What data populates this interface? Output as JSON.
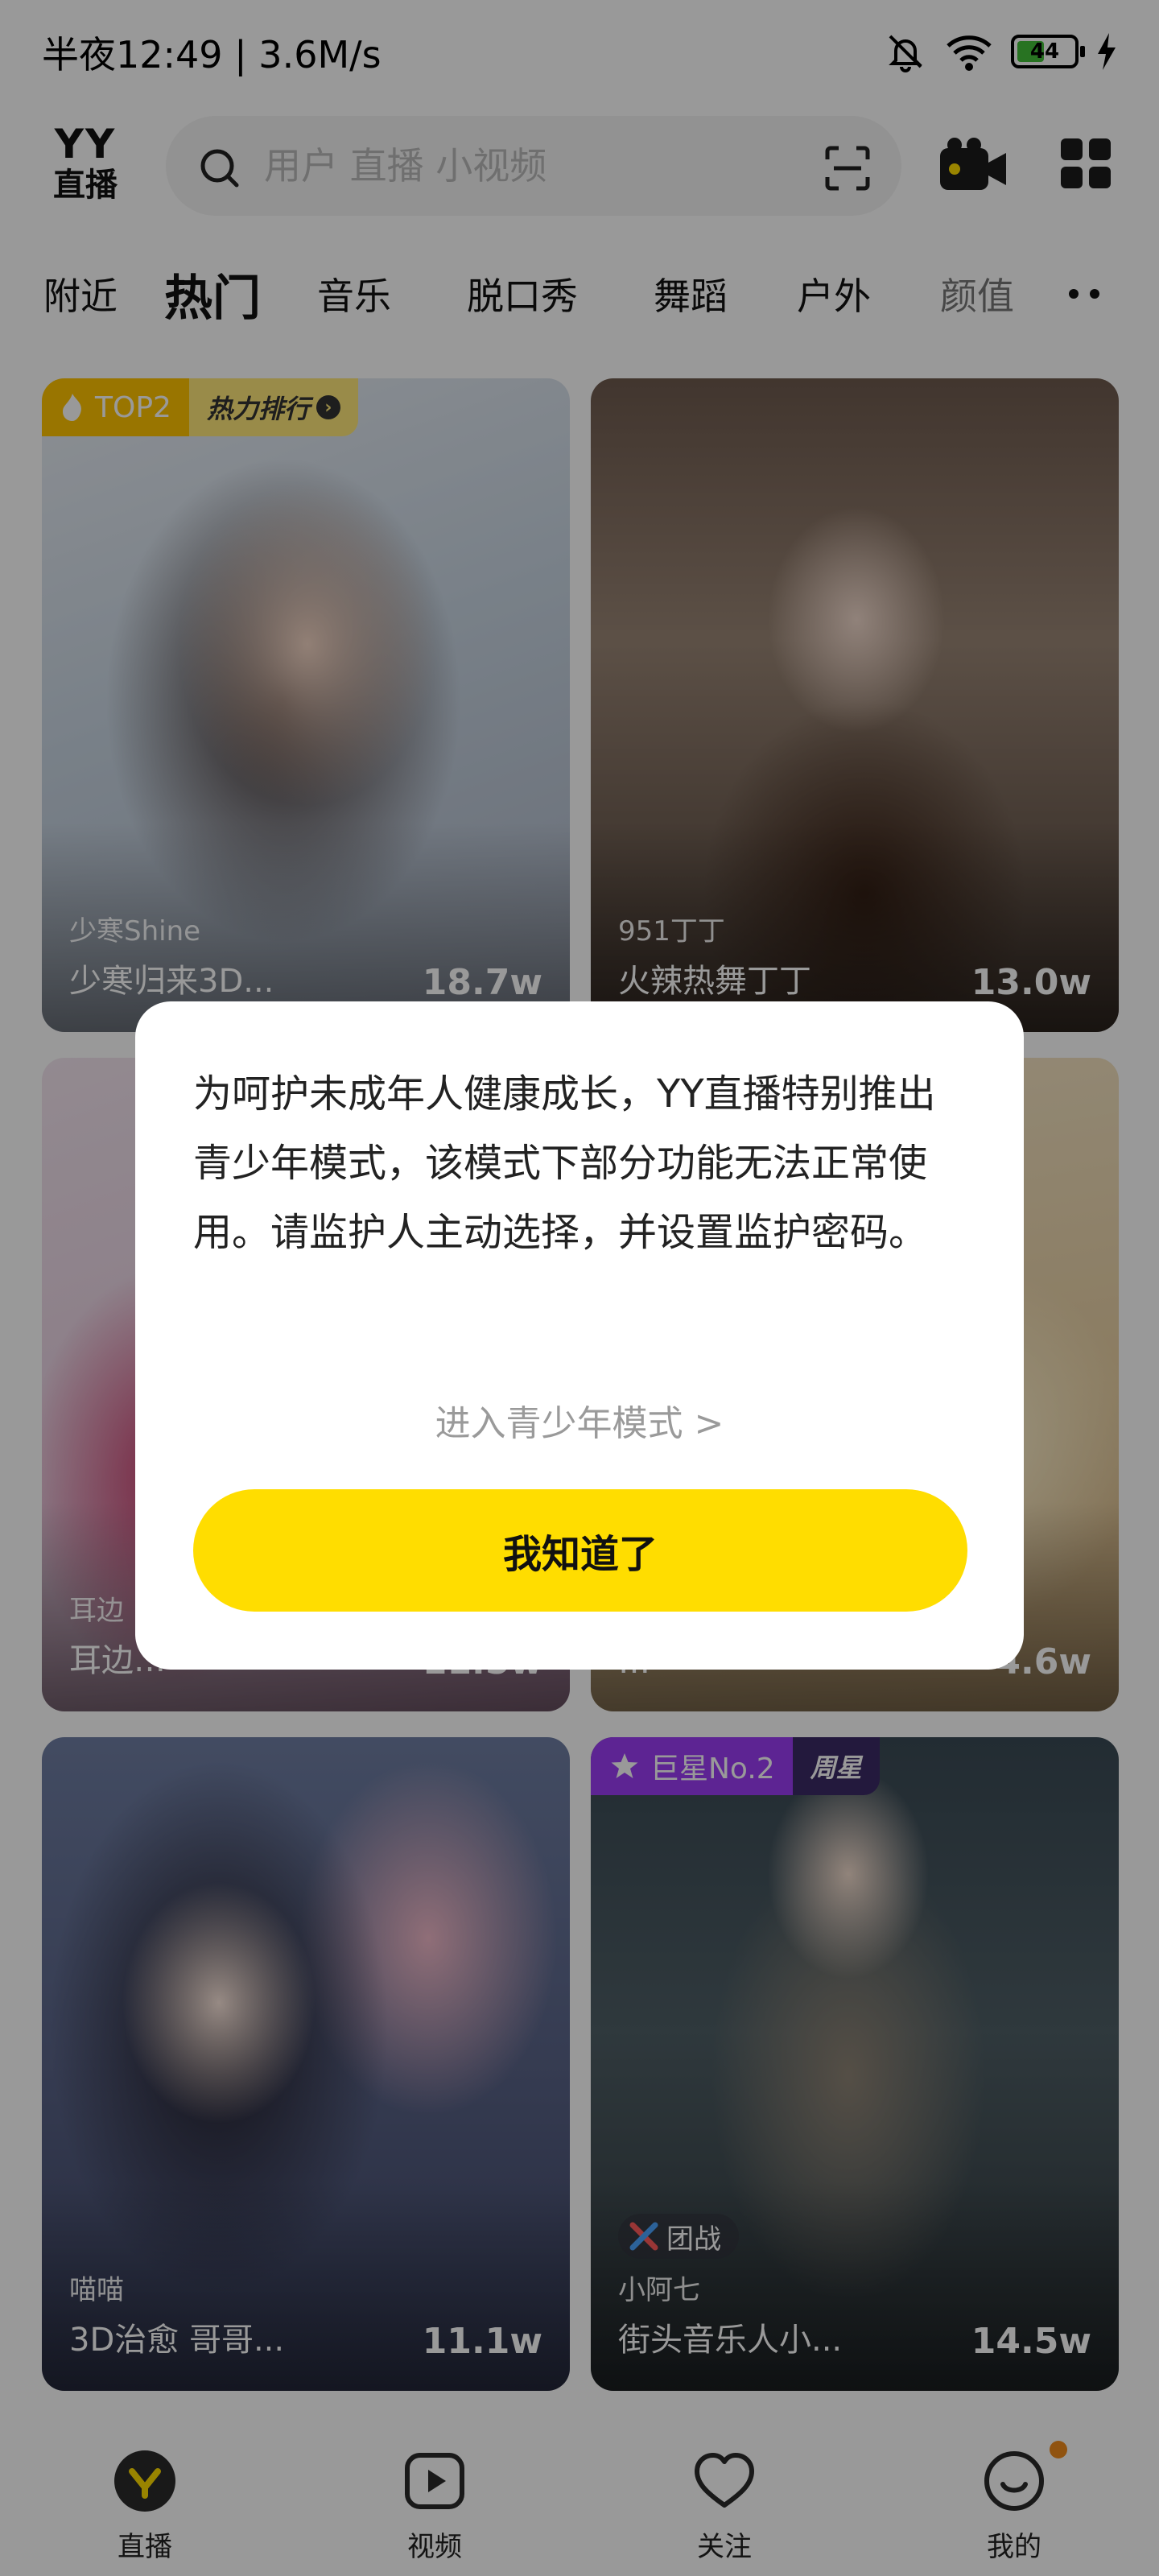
{
  "status_bar": {
    "text": "半夜12:49 | 3.6M/s",
    "battery": "44"
  },
  "header": {
    "logo_top": "YY",
    "logo_bottom": "直播",
    "search_placeholder": "用户 直播 小视频"
  },
  "tabs": [
    "附近",
    "热门",
    "音乐",
    "脱口秀",
    "舞蹈",
    "户外",
    "颜值"
  ],
  "active_tab": "热门",
  "cards": [
    {
      "user": "少寒Shine",
      "title": "少寒归来3D...",
      "views": "18.7w",
      "tag_a": "TOP2",
      "tag_b": "热力排行"
    },
    {
      "user": "951丁丁",
      "title": "火辣热舞丁丁",
      "views": "13.0w"
    },
    {
      "user": "耳边",
      "title": "耳边…",
      "views": "11.5w"
    },
    {
      "user": "",
      "title": "…",
      "views": "4.6w"
    },
    {
      "user": "喵喵",
      "title": "3D治愈 哥哥...",
      "views": "11.1w"
    },
    {
      "user": "小阿七",
      "title": "街头音乐人小...",
      "views": "14.5w",
      "tag_a": "巨星No.2",
      "tag_b": "周星",
      "team": "团战"
    }
  ],
  "dialog": {
    "message": "为呵护未成年人健康成长，YY直播特别推出青少年模式，该模式下部分功能无法正常使用。请监护人主动选择，并设置监护密码。",
    "link": "进入青少年模式 >",
    "button": "我知道了"
  },
  "bottom_nav": [
    {
      "label": "直播",
      "icon": "live-icon"
    },
    {
      "label": "视频",
      "icon": "video-play-icon"
    },
    {
      "label": "关注",
      "icon": "heart-icon"
    },
    {
      "label": "我的",
      "icon": "profile-icon"
    }
  ],
  "colors": {
    "accent": "#ffdd00",
    "tag_gold": "#ffc400",
    "tag_purple": "#9b3cf6",
    "notify_dot": "#f08a1c"
  }
}
